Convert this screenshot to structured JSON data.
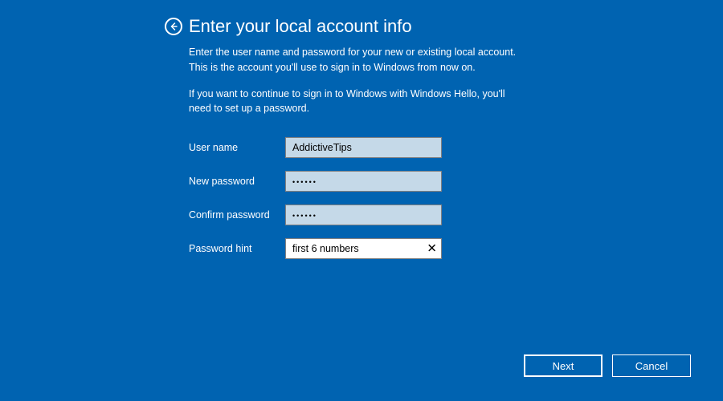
{
  "header": {
    "title": "Enter your local account info"
  },
  "descriptions": {
    "p1": "Enter the user name and password for your new or existing local account. This is the account you'll use to sign in to Windows from now on.",
    "p2": "If you want to continue to sign in to Windows with Windows Hello, you'll need to set up a password."
  },
  "form": {
    "username_label": "User name",
    "username_value": "AddictiveTips",
    "new_password_label": "New password",
    "new_password_value": "••••••",
    "confirm_password_label": "Confirm password",
    "confirm_password_value": "••••••",
    "hint_label": "Password hint",
    "hint_value": "first 6 numbers"
  },
  "buttons": {
    "next": "Next",
    "cancel": "Cancel"
  }
}
